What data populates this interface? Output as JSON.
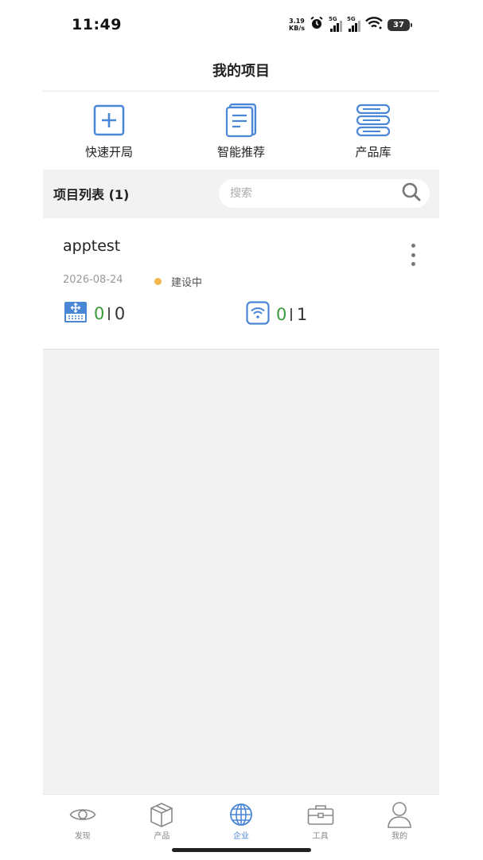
{
  "status_bar": {
    "time": "11:49",
    "net_speed_value": "3.19",
    "net_speed_unit": "KB/s",
    "sim1_label": "5G",
    "sim2_label": "5G",
    "battery": "37"
  },
  "header": {
    "title": "我的项目"
  },
  "quick_actions": [
    {
      "label": "快速开局",
      "icon": "plus-square-icon"
    },
    {
      "label": "智能推荐",
      "icon": "document-icon"
    },
    {
      "label": "产品库",
      "icon": "server-stack-icon"
    }
  ],
  "project_list": {
    "title": "项目列表 (1)",
    "search_placeholder": "搜索",
    "items": [
      {
        "name": "apptest",
        "date": "2026-08-24",
        "status": "建设中",
        "status_color": "#f2b84b",
        "switch": {
          "online": "0",
          "total": "0"
        },
        "ap": {
          "online": "0",
          "total": "1"
        }
      }
    ]
  },
  "tab_bar": {
    "active": "企业",
    "active_color": "#4a86d6",
    "tabs": [
      {
        "label": "发现",
        "icon": "eye-icon"
      },
      {
        "label": "产品",
        "icon": "box-icon"
      },
      {
        "label": "企业",
        "icon": "globe-icon"
      },
      {
        "label": "工具",
        "icon": "toolbox-icon"
      },
      {
        "label": "我的",
        "icon": "person-icon"
      }
    ]
  }
}
